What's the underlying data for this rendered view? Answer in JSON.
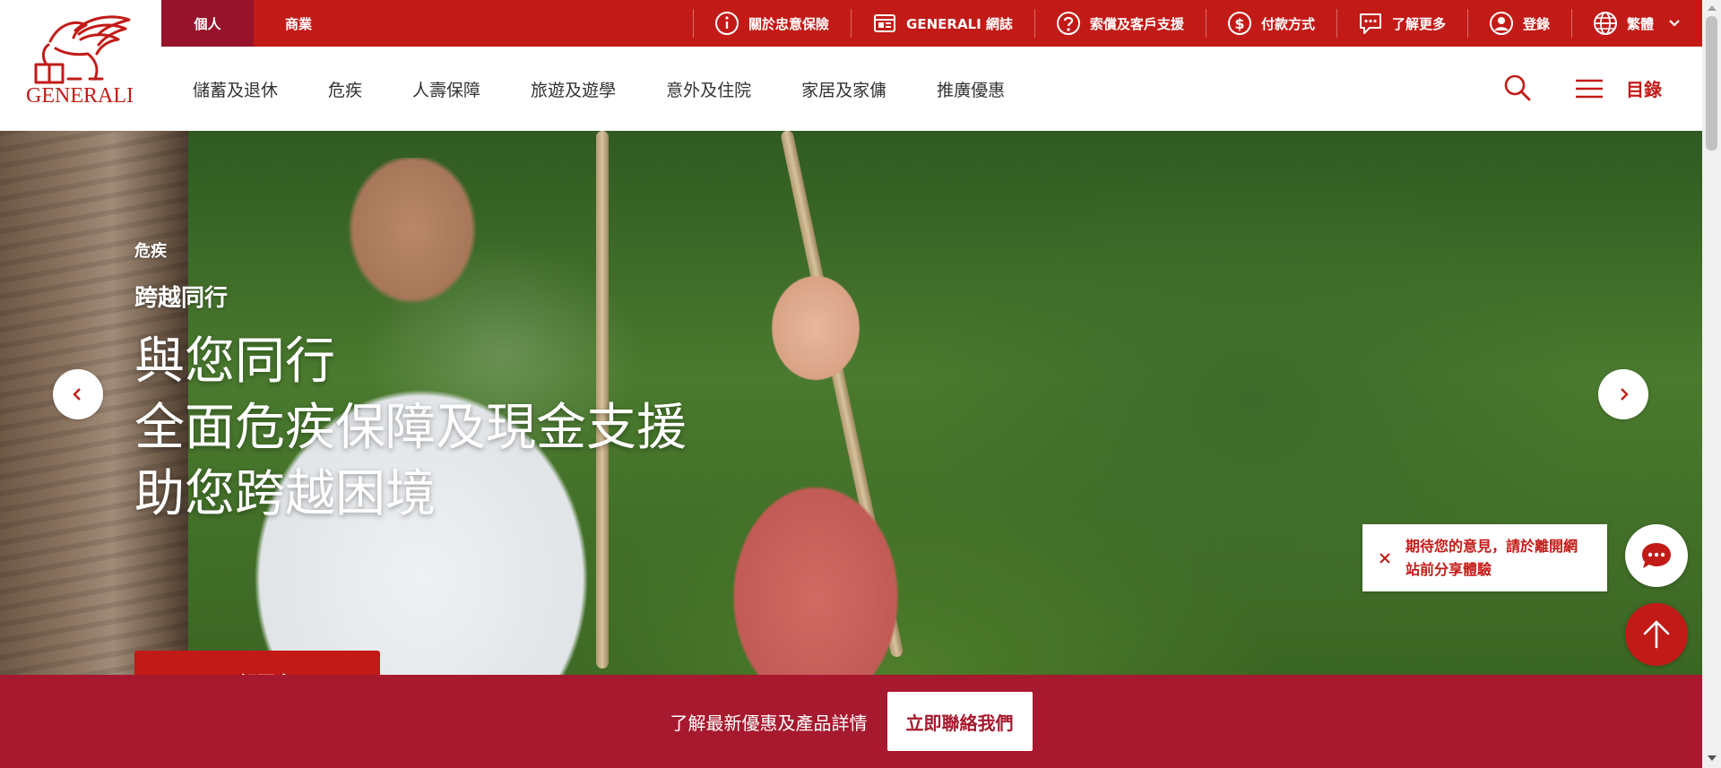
{
  "colors": {
    "brand_red": "#c21b17",
    "segment_active": "#96132b",
    "bottom_bar": "#a7192e"
  },
  "logo": {
    "text": "GENERALI",
    "icon": "winged-lion-logo"
  },
  "segments": {
    "personal": "個人",
    "business": "商業"
  },
  "utility": [
    {
      "label": "關於忠意保險",
      "icon": "info-icon"
    },
    {
      "label": "GENERALI 網誌",
      "icon": "news-icon"
    },
    {
      "label": "索償及客戶支援",
      "icon": "help-icon"
    },
    {
      "label": "付款方式",
      "icon": "dollar-icon"
    },
    {
      "label": "了解更多",
      "icon": "chat-bubble-icon"
    },
    {
      "label": "登錄",
      "icon": "user-icon"
    },
    {
      "label": "繁體",
      "icon": "globe-icon"
    }
  ],
  "nav": [
    "儲蓄及退休",
    "危疾",
    "人壽保障",
    "旅遊及遊學",
    "意外及住院",
    "家居及家傭",
    "推廣優惠"
  ],
  "menu_label": "目錄",
  "hero": {
    "eyebrow": "危疾",
    "subtitle": "跨越同行",
    "title_lines": [
      "與您同行",
      "全面危疾保障及現金支援",
      "助您跨越困境"
    ],
    "cta": "了解更多"
  },
  "feedback": {
    "text_line1": "期待您的意見，請於離開網",
    "text_line2": "站前分享體驗"
  },
  "bottom_bar": {
    "text": "了解最新優惠及產品詳情",
    "button": "立即聯絡我們"
  }
}
